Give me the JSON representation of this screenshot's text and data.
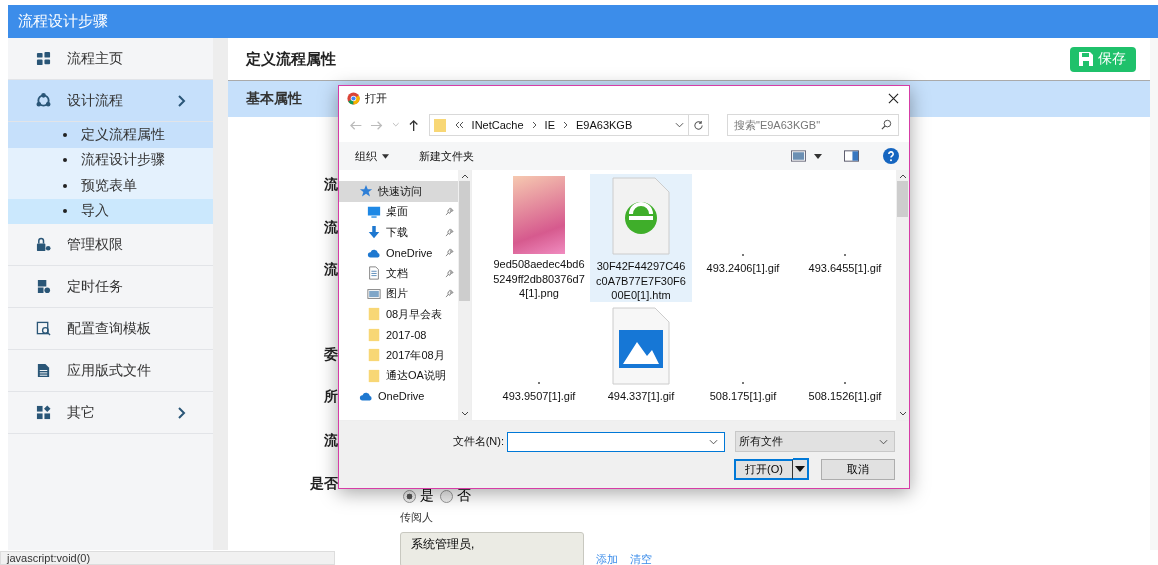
{
  "header": {
    "title": "流程设计步骤"
  },
  "sidebar": {
    "items": [
      {
        "label": "流程主页",
        "kind": "home",
        "selected": false,
        "has_arrow": false
      },
      {
        "label": "设计流程",
        "kind": "cycle",
        "selected": true,
        "has_arrow": true,
        "children": [
          {
            "label": "定义流程属性",
            "selected": true,
            "hovered": false
          },
          {
            "label": "流程设计步骤",
            "selected": false,
            "hovered": false
          },
          {
            "label": "预览表单",
            "selected": false,
            "hovered": false
          },
          {
            "label": "导入",
            "selected": false,
            "hovered": true
          }
        ]
      },
      {
        "label": "管理权限",
        "kind": "lock",
        "selected": false,
        "has_arrow": false
      },
      {
        "label": "定时任务",
        "kind": "task",
        "selected": false,
        "has_arrow": false
      },
      {
        "label": "配置查询模板",
        "kind": "query",
        "selected": false,
        "has_arrow": false
      },
      {
        "label": "应用版式文件",
        "kind": "file",
        "selected": false,
        "has_arrow": false
      },
      {
        "label": "其它",
        "kind": "grid",
        "selected": false,
        "has_arrow": true
      }
    ]
  },
  "main": {
    "title": "定义流程属性",
    "save_button": "保存",
    "section": "基本属性",
    "form_labels": [
      "流",
      "流",
      "流",
      "委",
      "所",
      "流",
      "是否"
    ],
    "radio_options": [
      {
        "label": "是",
        "selected": true
      },
      {
        "label": "否",
        "selected": false
      }
    ],
    "cc": {
      "label": "传阅人",
      "value": "系统管理员,",
      "links": [
        "添加",
        "清空"
      ]
    }
  },
  "dialog": {
    "title": "打开",
    "path": [
      "INetCache",
      "IE",
      "E9A63KGB"
    ],
    "search_placeholder": "搜索\"E9A63KGB\"",
    "toolbar": [
      "组织",
      "新建文件夹"
    ],
    "nav_items": [
      {
        "label": "快速访问",
        "kind": "star",
        "pinned": false,
        "selected": true
      },
      {
        "label": "桌面",
        "kind": "desktop",
        "pinned": true,
        "selected": false
      },
      {
        "label": "下载",
        "kind": "download",
        "pinned": true,
        "selected": false
      },
      {
        "label": "OneDrive",
        "kind": "cloud",
        "pinned": true,
        "selected": false
      },
      {
        "label": "文档",
        "kind": "doc",
        "pinned": true,
        "selected": false
      },
      {
        "label": "图片",
        "kind": "pictures",
        "pinned": true,
        "selected": false
      },
      {
        "label": "08月早会表",
        "kind": "folder",
        "pinned": false,
        "selected": false
      },
      {
        "label": "2017-08",
        "kind": "folder",
        "pinned": false,
        "selected": false
      },
      {
        "label": "2017年08月",
        "kind": "folder",
        "pinned": false,
        "selected": false
      },
      {
        "label": "通达OA说明",
        "kind": "folder",
        "pinned": false,
        "selected": false
      },
      {
        "label": "OneDrive",
        "kind": "cloud-root",
        "pinned": false,
        "selected": false
      }
    ],
    "files": [
      {
        "name": "9ed508aedec4bd65249ff2db80376d74[1].png",
        "kind": "photo",
        "selected": false
      },
      {
        "name": "30F42F44297C46c0A7B77E7F30F600E0[1].htm",
        "kind": "htm",
        "selected": true
      },
      {
        "name": "493.2406[1].gif",
        "kind": "gif",
        "selected": false
      },
      {
        "name": "493.6455[1].gif",
        "kind": "gif",
        "selected": false
      },
      {
        "name": "493.9507[1].gif",
        "kind": "gif",
        "selected": false
      },
      {
        "name": "494.337[1].gif",
        "kind": "image",
        "selected": false
      },
      {
        "name": "508.175[1].gif",
        "kind": "gif",
        "selected": false
      },
      {
        "name": "508.1526[1].gif",
        "kind": "gif",
        "selected": false
      }
    ],
    "filename_label": "文件名(N):",
    "filetype": "所有文件",
    "open_button": "打开(O)",
    "cancel_button": "取消"
  },
  "status_bar": "javascript:void(0)"
}
